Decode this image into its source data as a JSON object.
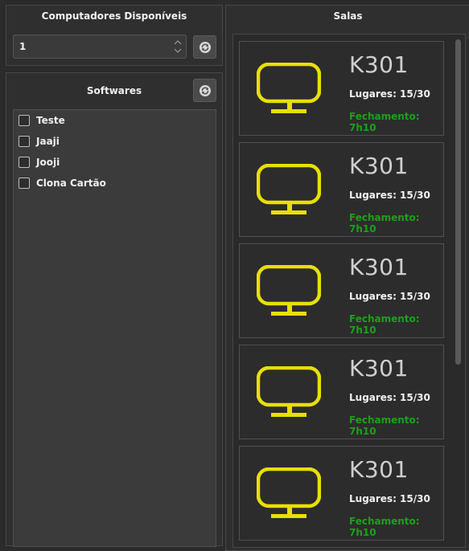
{
  "computadores": {
    "title": "Computadores Disponíveis",
    "value": "1",
    "refresh_icon": "refresh-icon"
  },
  "softwares": {
    "title": "Softwares",
    "refresh_icon": "refresh-icon",
    "items": [
      {
        "label": "Teste",
        "checked": false
      },
      {
        "label": "Jaaji",
        "checked": false
      },
      {
        "label": "Jooji",
        "checked": false
      },
      {
        "label": "Clona Cartão",
        "checked": false
      }
    ]
  },
  "salas": {
    "title": "Salas",
    "icon": "monitor-icon",
    "icon_color": "#e8e000",
    "status_color": "#1f9e1f",
    "rooms": [
      {
        "name": "K301",
        "seats": "Lugares: 15/30",
        "closing": "Fechamento: 7h10"
      },
      {
        "name": "K301",
        "seats": "Lugares: 15/30",
        "closing": "Fechamento: 7h10"
      },
      {
        "name": "K301",
        "seats": "Lugares: 15/30",
        "closing": "Fechamento: 7h10"
      },
      {
        "name": "K301",
        "seats": "Lugares: 15/30",
        "closing": "Fechamento: 7h10"
      },
      {
        "name": "K301",
        "seats": "Lugares: 15/30",
        "closing": "Fechamento: 7h10"
      }
    ]
  }
}
